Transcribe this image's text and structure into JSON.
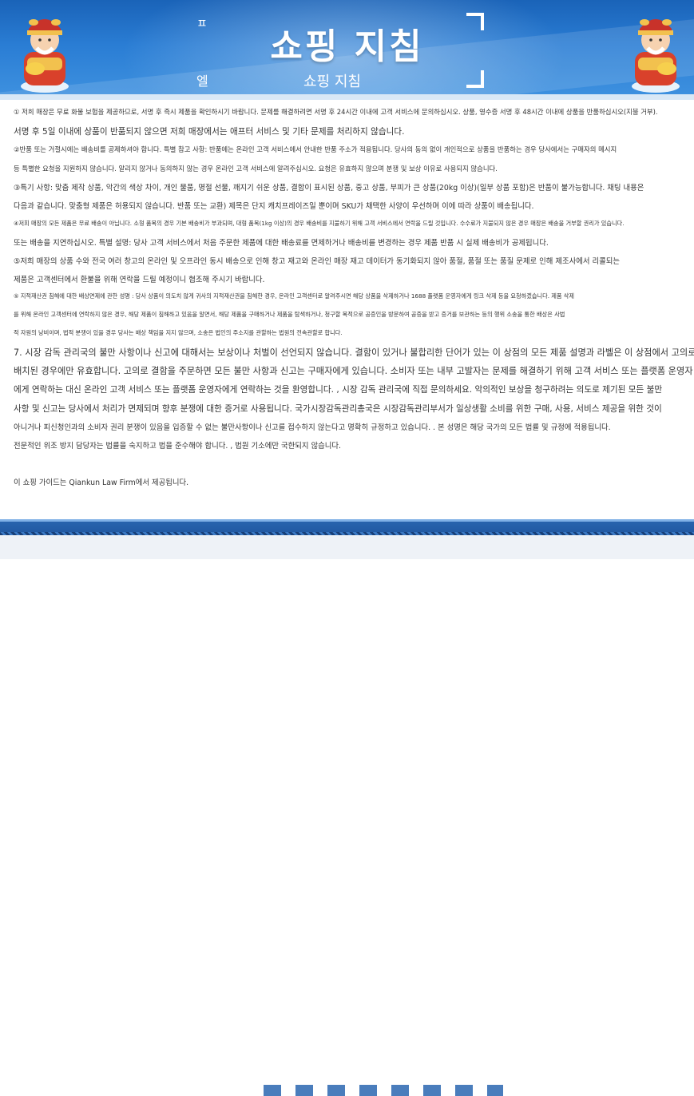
{
  "header": {
    "title": "쇼핑 지침",
    "subtitle": "쇼핑 지침",
    "left_mark_top": "ㅍ",
    "left_mark_bottom": "엘"
  },
  "paragraphs": [
    "① 저희 매장은 무료 화물 보험을 제공하므로, 서명 후 즉시 제품을 확인하시기 바랍니다. 문제를 해결하려면 서명 후 24시간 이내에 고객 서비스에 문의하십시오. 상품, 영수증 서명 후 48시간 이내에 상품을 반품하십시오(지불 거부).",
    "서명 후 5일 이내에 상품이 반품되지 않으면 저희 매장에서는 애프터 서비스 및 기타 문제를 처리하지 않습니다.",
    "②반품 또는 거절시에는 배송비를 공제하셔야 합니다. 특별 참고 사항: 반품에는 온라인 고객 서비스에서 안내한 반품 주소가 적용됩니다. 당사의 동의 없이 개인적으로 상품을 반품하는 경우 당사에서는 구매자의 메시지",
    "등 특별한 요청을 지원하지 않습니다. 알리지 않거나 동의하지 않는 경우 온라인 고객 서비스에 알려주십시오. 요청은 유효하지 않으며 분쟁 및 보상 이유로 사용되지 않습니다.",
    "③특기 사항: 맞춤 제작 상품, 악간의 색상 차이, 개인 물품, 명절 선물, 깨지기 쉬운 상품, 결함이 표시된 상품, 중고 상품, 부피가 큰 상품(20kg 이상)(일부 상품 포함)은 반품이 불가능합니다. 채팅 내용은",
    "다음과 같습니다. 맞춤형 제품은 허용되지 않습니다. 반품 또는 교환) 제목은 단지 캐치프레이즈일 뿐이며 SKU가 채택한 사양이 우선하며 이에 따라 상품이 배송됩니다.",
    "④저희 매장의 모든 제품은 무료 배송이 아닙니다. 소형 품목의 경우 기본 배송비가 부과되며, 대형 품목(1kg 이상)의 경우 배송비를 지불하기 위해 고객 서비스에서 연락을 드릴 것입니다. 수수료가 지불되지 않은 경우 매장은 배송을 거부할 권리가 있습니다.",
    "또는 배송을 지연하십시오. 특별 설명: 당사 고객 서비스에서 처음 주문한 제품에 대한 배송료를 면제하거나 배송비를 변경하는 경우 제품 반품 시 실제 배송비가 공제됩니다.",
    "⑤저희 매장의 상품 수와 전국 여러 창고의 온라인 및 오프라인 동시 배송으로 인해 창고 재고와 온라인 매장 재고 데이터가 동기화되지 않아 품절, 품절 또는 품질 문제로 인해 제조사에서 리콜되는",
    "제품은 고객센터에서 환불을 위해 연락을 드릴 예정이니 협조해 주시기 바랍니다.",
    "⑤ 지적재산권 침해에 대한 배상면제에 관한 성명 : 당사 상품이 의도치 않게 귀사의 지적재산권을 침해한 경우, 온라인 고객센터로 알려주시면 해당 상품을 삭제하거나 1688 플랫폼 운영자에게 링크 삭제 등을 요청하겠습니다. 제품 삭제",
    "를 위해 온라인 고객센터에 연락하지 않은 경우, 해당 제품이 침해하고 있음을 알면서, 해당 제품을 구매하거나 제품을 탐색하거나, 청구할 목적으로 공증인을 방문하여 공증을 받고 증거를 보관하는 등의 행위 소송을 통한 배상은 사법",
    "적 자원의 낭비이며, 법적 분쟁이 있을 경우 당사는 배상 책임을 지지 않으며, 소송은 법인의 주소지를 관할하는 법원의 전속관할로 합니다.",
    "7. 시장 감독 관리국의 불만 사항이나 신고에 대해서는 보상이나 처벌이 선언되지 않습니다. 결함이 있거나 불합리한 단어가 있는 이 상점의 모든 제품 설명과 라벨은 이 상점에서 고의로",
    "배치된 경우에만 유효합니다. 고의로 결함을 주문하면 모든 불만 사항과 신고는 구매자에게 있습니다. 소비자 또는 내부 고발자는 문제를 해결하기 위해 고객 서비스 또는 플랫폼 운영자",
    "에게 연락하는 대신 온라인 고객 서비스 또는 플랫폼 운영자에게 연락하는 것을 환영합니다. , 시장 감독 관리국에 직접 문의하세요. 악의적인 보상을 청구하려는 의도로 제기된 모든 불만",
    "사항 및 신고는 당사에서 처리가 면제되며 향후 분쟁에 대한 증거로 사용됩니다. 국가시장감독관리총국은 시장감독관리부서가 일상생활 소비를 위한 구매, 사용, 서비스 제공을 위한 것이",
    "아니거나 피신청인과의 소비자 권리 분쟁이 있음을 입증할 수 없는 불만사항이나 신고를 접수하지 않는다고 명확히 규정하고 있습니다. . 본 성명은 해당 국가의 모든 법률 및 규정에 적용됩니다.",
    "전문적인 위조 방지 담당자는 법률을 숙지하고 법을 준수해야 합니다. , 법원 기소에만 국한되지 않습니다.",
    "이 쇼핑 가이드는 Qiankun Law Firm에서 제공됩니다."
  ]
}
